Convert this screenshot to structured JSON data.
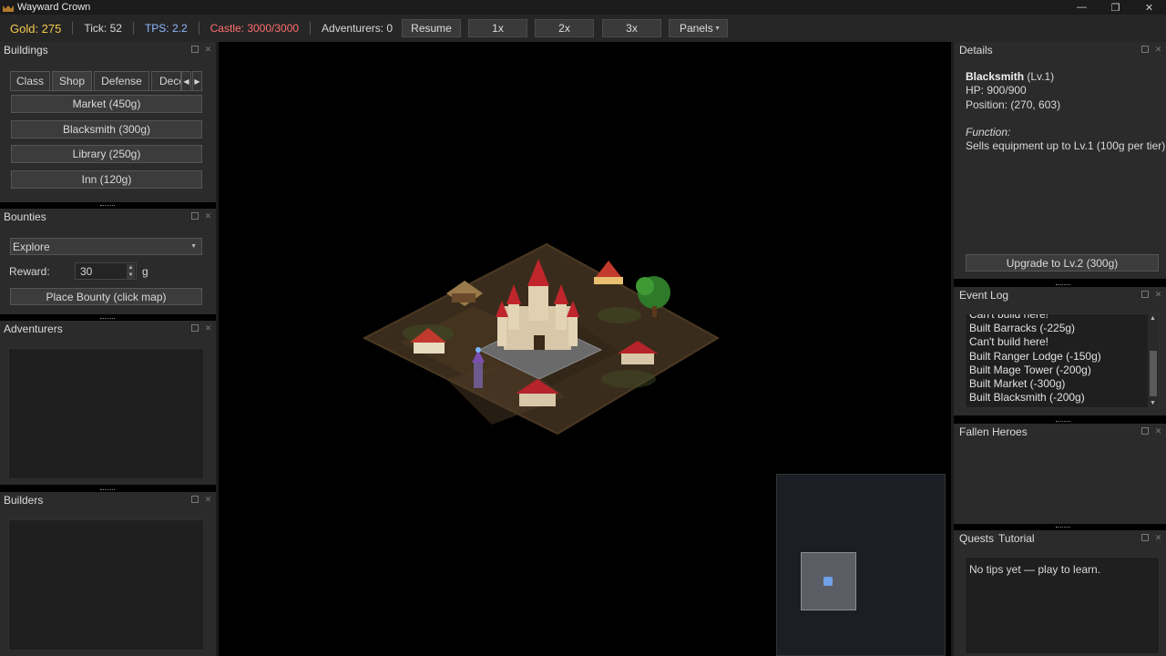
{
  "window": {
    "title": "Wayward Crown"
  },
  "topbar": {
    "gold": "Gold: 275",
    "tick": "Tick: 52",
    "tps": "TPS: 2.2",
    "castle": "Castle: 3000/3000",
    "adventurers": "Adventurers: 0",
    "resume": "Resume",
    "speed1": "1x",
    "speed2": "2x",
    "speed3": "3x",
    "panels": "Panels"
  },
  "buildings": {
    "title": "Buildings",
    "tabs": [
      "Class",
      "Shop",
      "Defense",
      "Deco"
    ],
    "active_tab": "Shop",
    "items": [
      "Market (450g)",
      "Blacksmith (300g)",
      "Library (250g)",
      "Inn (120g)"
    ]
  },
  "bounties": {
    "title": "Bounties",
    "type_selected": "Explore",
    "reward_label": "Reward:",
    "reward_value": "30",
    "reward_unit": "g",
    "place_button": "Place Bounty (click map)"
  },
  "adventurers": {
    "title": "Adventurers"
  },
  "builders": {
    "title": "Builders"
  },
  "details": {
    "title": "Details",
    "name": "Blacksmith",
    "level": "(Lv.1)",
    "hp": "HP: 900/900",
    "position": "Position: (270, 603)",
    "function_label": "Function:",
    "function_text": "Sells equipment up to Lv.1 (100g per tier)",
    "upgrade_button": "Upgrade to Lv.2 (300g)"
  },
  "event_log": {
    "title": "Event Log",
    "lines": [
      "Can't build here!",
      "Built Barracks (-225g)",
      "Can't build here!",
      "Built Ranger Lodge (-150g)",
      "Built Mage Tower (-200g)",
      "Built Market (-300g)",
      "Built Blacksmith (-200g)"
    ]
  },
  "fallen_heroes": {
    "title": "Fallen Heroes"
  },
  "quests": {
    "title_primary": "Quests",
    "title_secondary": "Tutorial",
    "text": "No tips yet — play to learn."
  },
  "colors": {
    "gold": "#f2c94c",
    "tps": "#8fb8ff",
    "castle": "#ff6f6f",
    "panel_bg": "#2b2b2b",
    "map_bg": "#000000"
  }
}
